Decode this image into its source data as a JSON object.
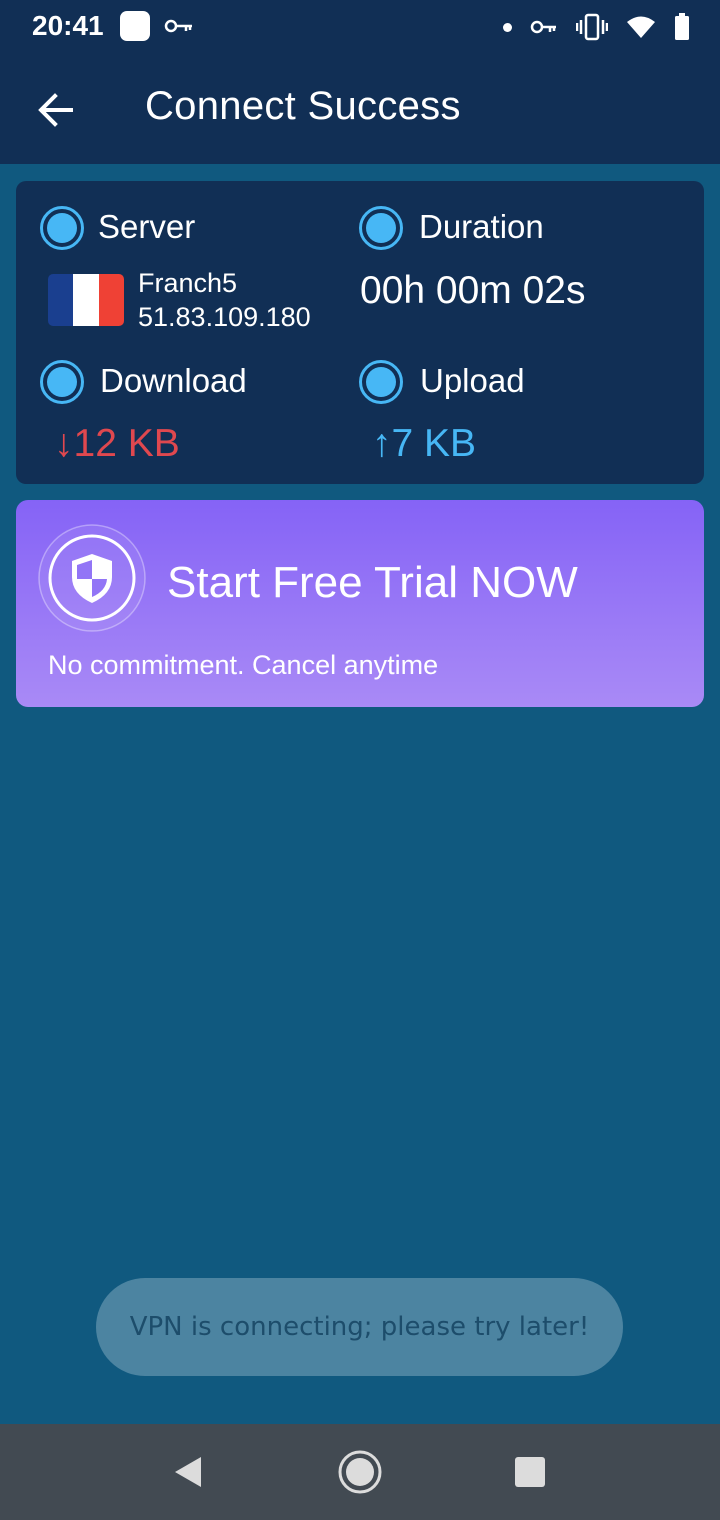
{
  "status_bar": {
    "time": "20:41"
  },
  "header": {
    "title": "Connect Success",
    "back_icon": "arrow-left-icon"
  },
  "stats": {
    "server": {
      "label": "Server",
      "name": "Franch5",
      "ip": "51.83.109.180",
      "flag_colors": [
        "#1a3f8f",
        "#ffffff",
        "#ef4135"
      ]
    },
    "duration": {
      "label": "Duration",
      "value": "00h 00m 02s"
    },
    "download": {
      "label": "Download",
      "value": "↓12 KB"
    },
    "upload": {
      "label": "Upload",
      "value": "↑7 KB"
    }
  },
  "trial_banner": {
    "title": "Start Free Trial NOW",
    "subtitle": "No commitment. Cancel anytime",
    "icon": "shield-icon"
  },
  "toast": {
    "message": "VPN is connecting; please try later!"
  },
  "colors": {
    "header_bg": "#112f55",
    "page_bg": "#10597f",
    "accent_blue": "#47b7f5",
    "download_red": "#e0484f",
    "banner_top": "#8563f6",
    "banner_bottom": "#a98af6"
  }
}
